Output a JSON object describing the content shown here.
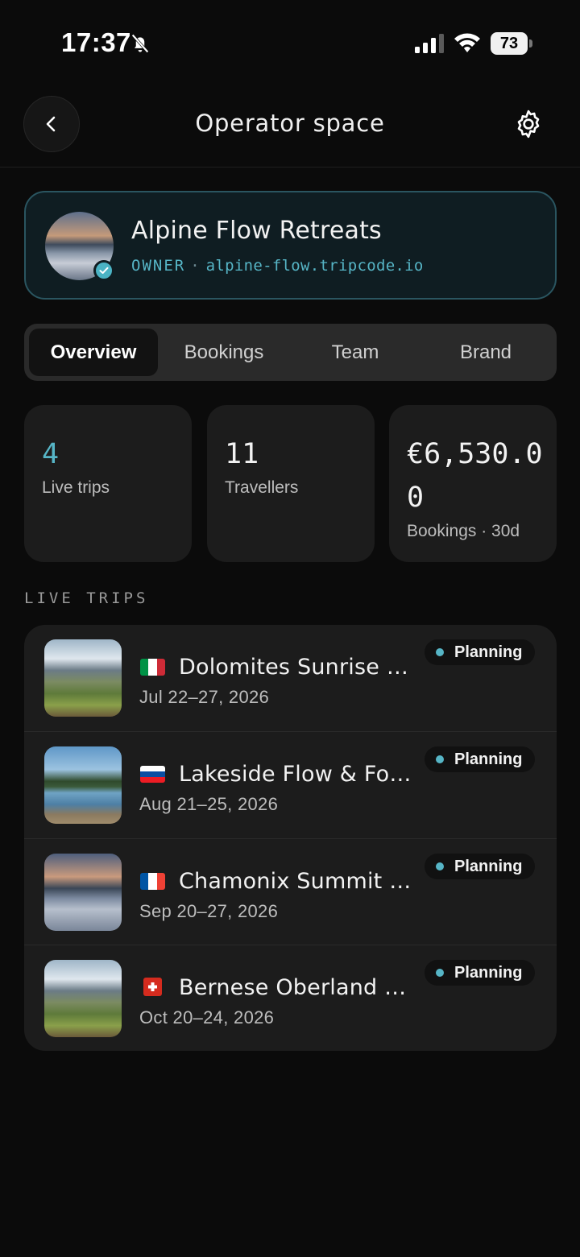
{
  "status_bar": {
    "time": "17:37",
    "battery": "73"
  },
  "header": {
    "title": "Operator space"
  },
  "operator": {
    "name": "Alpine Flow Retreats",
    "role": "OWNER",
    "separator": "·",
    "domain": "alpine-flow.tripcode.io"
  },
  "tabs": [
    {
      "label": "Overview",
      "active": true
    },
    {
      "label": "Bookings",
      "active": false
    },
    {
      "label": "Team",
      "active": false
    },
    {
      "label": "Brand",
      "active": false
    }
  ],
  "stats": [
    {
      "value": "4",
      "label": "Live trips"
    },
    {
      "value": "11",
      "label": "Travellers"
    },
    {
      "value": "€6,530.00",
      "label": "Bookings · 30d"
    }
  ],
  "section_label": "LIVE TRIPS",
  "trips": [
    {
      "title": "Dolomites Sunrise Y...",
      "dates": "Jul 22–27, 2026",
      "status": "Planning",
      "flag": "italy-flag-icon"
    },
    {
      "title": "Lakeside Flow & Fora...",
      "dates": "Aug 21–25, 2026",
      "status": "Planning",
      "flag": "slovenia-flag-icon"
    },
    {
      "title": "Chamonix Summit &...",
      "dates": "Sep 20–27, 2026",
      "status": "Planning",
      "flag": "france-flag-icon"
    },
    {
      "title": "Bernese Oberland Gl...",
      "dates": "Oct 20–24, 2026",
      "status": "Planning",
      "flag": "switzerland-flag-icon"
    }
  ],
  "colors": {
    "accent": "#56b5c6",
    "card": "#1c1c1c",
    "background": "#0b0b0b"
  }
}
